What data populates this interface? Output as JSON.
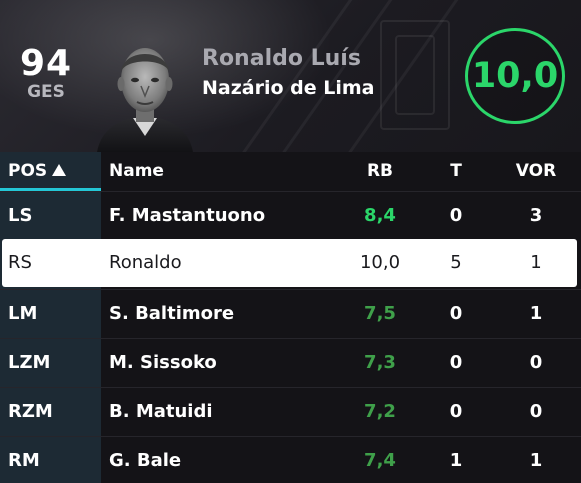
{
  "player": {
    "rating": "94",
    "rating_label": "GES",
    "first_name": "Ronaldo Luís",
    "last_name": "Nazário de Lima",
    "match_score": "10,0"
  },
  "table": {
    "headers": {
      "pos": "POS",
      "name": "Name",
      "rb": "RB",
      "t": "T",
      "vor": "VOR"
    },
    "sort_column": "POS",
    "sort_direction": "ascending",
    "rows": [
      {
        "pos": "LS",
        "name": "F. Mastantuono",
        "rb": "8,4",
        "t": "0",
        "vor": "3",
        "rb_color": "#2bd66a",
        "selected": false
      },
      {
        "pos": "RS",
        "name": "Ronaldo",
        "rb": "10,0",
        "t": "5",
        "vor": "1",
        "rb_color": "#1a1a1e",
        "selected": true
      },
      {
        "pos": "LM",
        "name": "S. Baltimore",
        "rb": "7,5",
        "t": "0",
        "vor": "1",
        "rb_color": "#3fa04a",
        "selected": false
      },
      {
        "pos": "LZM",
        "name": "M. Sissoko",
        "rb": "7,3",
        "t": "0",
        "vor": "0",
        "rb_color": "#3fa04a",
        "selected": false
      },
      {
        "pos": "RZM",
        "name": "B. Matuidi",
        "rb": "7,2",
        "t": "0",
        "vor": "0",
        "rb_color": "#3fa04a",
        "selected": false
      },
      {
        "pos": "RM",
        "name": "G. Bale",
        "rb": "7,4",
        "t": "1",
        "vor": "1",
        "rb_color": "#3fa04a",
        "selected": false
      }
    ]
  },
  "colors": {
    "accent_cyan": "#24c7d6",
    "score_green": "#2bd66a",
    "rating_green": "#3fa04a",
    "pos_column_bg": "#1d2a34"
  }
}
